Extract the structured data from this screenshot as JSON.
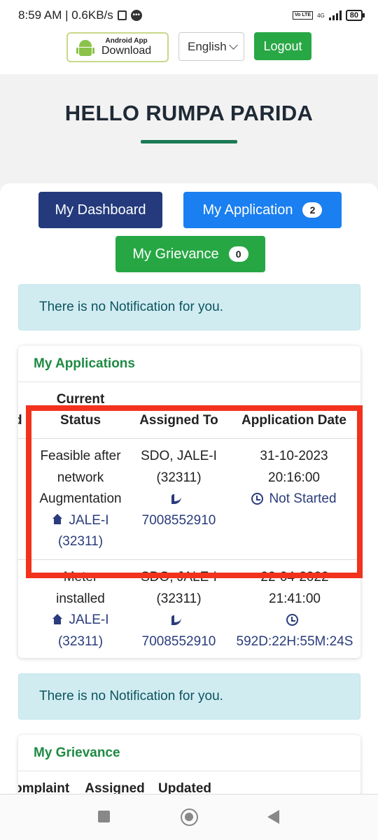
{
  "status_bar": {
    "time_speed": "8:59 AM | 0.6KB/s",
    "volte": "Vo LTE",
    "network": "4G",
    "battery": "80"
  },
  "header": {
    "android_small": "Android App",
    "android_big": "Download",
    "language": "English",
    "logout": "Logout"
  },
  "greeting": "HELLO RUMPA PARIDA",
  "buttons": {
    "dashboard": "My Dashboard",
    "application": "My Application",
    "application_count": "2",
    "grievance": "My Grievance",
    "grievance_count": "0"
  },
  "notice": "There is no Notification for you.",
  "applications": {
    "title": "My Applications",
    "headers": {
      "current": "Current",
      "status": "Status",
      "assigned_to": "Assigned To",
      "app_date": "Application Date",
      "left_cut": "d"
    },
    "rows": [
      {
        "status_l1": "Feasible after",
        "status_l2": "network",
        "status_l3": "Augmentation",
        "office": "JALE-I",
        "office_code": "(32311)",
        "assigned_l1": "SDO, JALE-I",
        "assigned_l2": "(32311)",
        "phone": "7008552910",
        "date": "31-10-2023",
        "time": "20:16:00",
        "elapsed": "Not Started"
      },
      {
        "status_top": "Meter",
        "status_l2": "installed",
        "office": "JALE-I",
        "office_code": "(32311)",
        "assigned_top": "SDO, JALE-I",
        "assigned_l2": "(32311)",
        "phone": "7008552910",
        "date_top": "22-04-2022",
        "time": "21:41:00",
        "elapsed": "592D:22H:55M:24S"
      }
    ]
  },
  "grievance": {
    "title": "My Grievance",
    "headers": {
      "complaint": "omplaint",
      "assigned": "Assigned",
      "updated": "Updated"
    }
  },
  "colors": {
    "accent_green": "#27a744",
    "navy": "#243a7c",
    "blue": "#1a7ff0",
    "highlight": "#f2321c"
  }
}
